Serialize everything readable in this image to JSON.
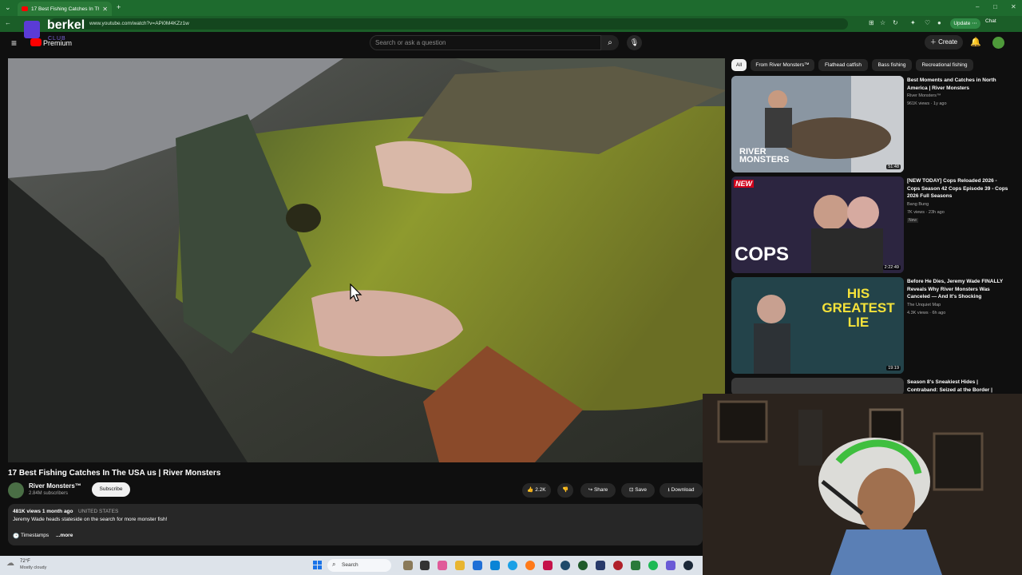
{
  "browser": {
    "tab_title": "17 Best Fishing Catches In The",
    "url": "www.youtube.com/watch?v=APi0M4KZz1w",
    "update_label": "Update",
    "chat_label": "Chat"
  },
  "overlay": {
    "brand": "berkel",
    "brand_sub": "CLUB"
  },
  "masthead": {
    "premium_label": "Premium",
    "search_placeholder": "Search or ask a question",
    "create_label": "Create"
  },
  "video": {
    "title": "17 Best Fishing Catches In The USA us | River Monsters",
    "channel": "River Monsters™",
    "subscribers": "2.84M subscribers",
    "subscribe_label": "Subscribe",
    "likes": "2.2K",
    "share_label": "Share",
    "save_label": "Save",
    "download_label": "Download",
    "stats": "481K views  1 month ago",
    "country": "UNITED STATES",
    "description": "Jeremy Wade heads stateside on the search for more monster fish!",
    "timestamps_label": "Timestamps",
    "more_label": "...more"
  },
  "chips": [
    "All",
    "From River Monsters™",
    "Flathead catfish",
    "Bass fishing",
    "Recreational fishing"
  ],
  "recommendations": [
    {
      "title": "Best Moments and Catches in North America | River Monsters",
      "channel": "River Monsters™",
      "meta": "961K views · 1y ago",
      "duration": "51:48",
      "thumb_text": "RIVER MONSTERS"
    },
    {
      "title": "[NEW TODAY] Cops Reloaded 2026 - Cops Season 42 Cops Episode 39 - Cops 2026 Full Seasons",
      "channel": "Bang Bung",
      "meta": "7K views · 23h ago",
      "badge": "New",
      "duration": "2:22:49",
      "thumb_text": "COPS",
      "thumb_badge": "NEW"
    },
    {
      "title": "Before He Dies, Jeremy Wade FINALLY Reveals Why River Monsters Was Canceled — And It's Shocking",
      "channel": "The Unquiet Map",
      "meta": "4.3K views · 6h ago",
      "duration": "19:19",
      "thumb_text": "HIS GREATEST LIE"
    },
    {
      "title": "Season 8's Sneakiest Hides | Contraband: Seized at the Border |",
      "channel": "",
      "meta": ""
    }
  ],
  "taskbar": {
    "temp": "72°F",
    "weather": "Mostly cloudy",
    "search_label": "Search"
  },
  "colors": {
    "browser_green": "#1e6b2e",
    "yt_red": "#ff0000",
    "bg": "#0f0f0f"
  }
}
